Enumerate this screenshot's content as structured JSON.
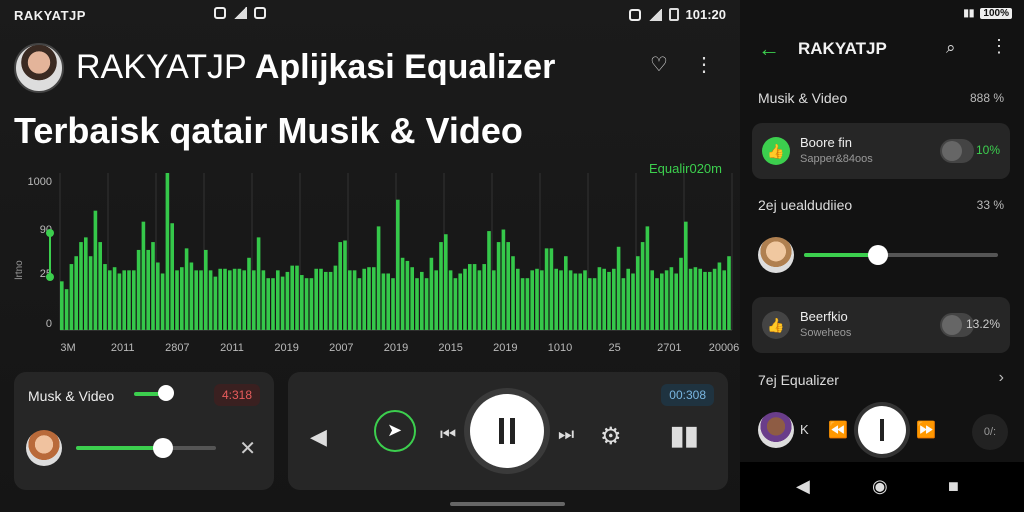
{
  "left": {
    "status": {
      "brand": "RAKYATJP",
      "time": "101:20"
    },
    "headline": {
      "line1_brand": "RAKYATJP",
      "line1_rest": "Aplijkasi Equalizer",
      "line2": "Terbaisk qatair Musik & Video"
    },
    "icons": {
      "favorite": "heart-icon",
      "more": "more-vertical-icon"
    }
  },
  "chart_data": {
    "type": "bar",
    "legend": "Equalir020m",
    "y_ticks": [
      "1000",
      "90",
      "25",
      "0"
    ],
    "y_label": "lrtno",
    "x_ticks": [
      "3M",
      "2011",
      "2807",
      "2011",
      "2019",
      "2007",
      "2019",
      "2015",
      "2019",
      "1010",
      "25",
      "2701",
      "20006"
    ],
    "ylim": [
      0,
      1000
    ],
    "values": [
      310,
      260,
      420,
      470,
      560,
      590,
      470,
      760,
      560,
      420,
      380,
      400,
      360,
      380,
      380,
      380,
      510,
      690,
      510,
      560,
      430,
      360,
      1000,
      680,
      380,
      400,
      520,
      430,
      380,
      380,
      510,
      380,
      340,
      390,
      390,
      380,
      390,
      390,
      380,
      460,
      380,
      590,
      380,
      330,
      330,
      380,
      340,
      370,
      410,
      410,
      350,
      330,
      330,
      390,
      390,
      370,
      370,
      410,
      560,
      570,
      380,
      380,
      330,
      390,
      400,
      400,
      660,
      360,
      360,
      330,
      830,
      460,
      440,
      400,
      330,
      370,
      330,
      460,
      380,
      560,
      610,
      380,
      330,
      360,
      390,
      420,
      420,
      380,
      420,
      630,
      380,
      560,
      640,
      560,
      470,
      390,
      330,
      330,
      380,
      390,
      380,
      520,
      520,
      390,
      380,
      470,
      380,
      360,
      360,
      380,
      330,
      330,
      400,
      390,
      370,
      390,
      530,
      330,
      390,
      360,
      470,
      560,
      660,
      380,
      330,
      360,
      380,
      400,
      360,
      460,
      690,
      390,
      400,
      390,
      370,
      370,
      390,
      430,
      380,
      470
    ]
  },
  "cardA": {
    "title": "Musk & Video",
    "badge": "4:318",
    "icons": {
      "close": "close-icon"
    },
    "volume": 0.62
  },
  "cardB": {
    "badge": "00:308",
    "icons": {
      "speaker": "speaker-icon",
      "nav": "navigation-icon",
      "prev": "skip-previous-icon",
      "pause": "pause-icon",
      "next": "skip-next-icon",
      "settings": "gear-icon",
      "bars": "equalizer-bars-icon"
    }
  },
  "right": {
    "status": {
      "battery": "100%"
    },
    "header": {
      "title": "RAKYATJP",
      "back": "back-arrow-icon",
      "search": "search-icon",
      "more": "more-vertical-icon"
    },
    "section1": {
      "label": "Musik & Video",
      "value": "888 %"
    },
    "card1": {
      "title": "Boore fin",
      "subtitle": "Sapper&84oos",
      "pct": "10%"
    },
    "section2": {
      "label": "2ej uealdudiieo",
      "value": "33 %"
    },
    "slider_value": 0.38,
    "card2": {
      "title": "Beerfkio",
      "subtitle": "Soweheos",
      "pct": "13.2%"
    },
    "section3": {
      "label": "7ej Equalizer",
      "chevron": "chevron-right-icon"
    },
    "player": {
      "badge": "0/:",
      "skip_glyph": "K"
    },
    "navbar": {
      "back": "back-triangle-icon",
      "home": "home-circle-icon",
      "recents": "recents-square-icon"
    }
  }
}
